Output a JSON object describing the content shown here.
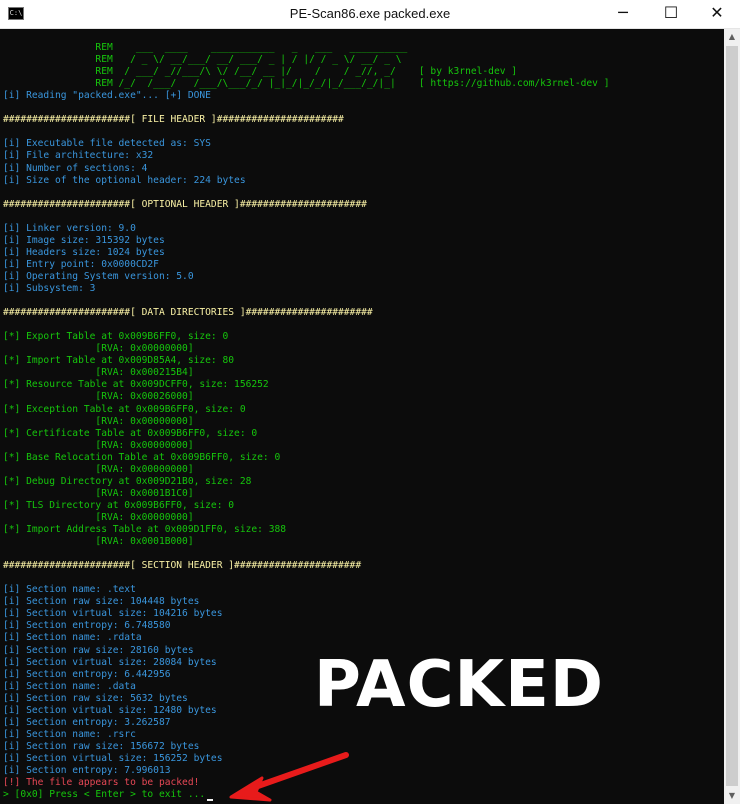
{
  "window": {
    "title": "PE-Scan86.exe  packed.exe",
    "icon_label": "C:\\",
    "buttons": {
      "minimize": "─",
      "maximize": "☐",
      "close": "✕"
    }
  },
  "console": {
    "lines": [
      {
        "text": "                REM    ___  ____    ___________   _   ___   __________",
        "color": "green"
      },
      {
        "text": "                REM   / _ \\/ __/___/ __/ ___/ _ | / |/ / _ \\/ __/ _ \\",
        "color": "green"
      },
      {
        "text": "                REM  / ___/ _//___/\\ \\/ /__/ __ |/    /    / _//, _/    [ by k3rnel-dev ]",
        "color": "green"
      },
      {
        "text": "                REM /_/  /___/   /___/\\___/_/ |_|_/|_/_/|_/___/_/|_|    [ https://github.com/k3rnel-dev ]",
        "color": "green"
      },
      {
        "text": "[i] Reading \"packed.exe\"... [+] DONE",
        "color": "cyan"
      },
      {
        "text": "",
        "color": "gray"
      },
      {
        "text": "######################[ FILE HEADER ]######################",
        "color": "yellow"
      },
      {
        "text": "",
        "color": "gray"
      },
      {
        "text": "[i] Executable file detected as: SYS",
        "color": "cyan"
      },
      {
        "text": "[i] File architecture: x32",
        "color": "cyan"
      },
      {
        "text": "[i] Number of sections: 4",
        "color": "cyan"
      },
      {
        "text": "[i] Size of the optional header: 224 bytes",
        "color": "cyan"
      },
      {
        "text": "",
        "color": "gray"
      },
      {
        "text": "######################[ OPTIONAL HEADER ]######################",
        "color": "yellow"
      },
      {
        "text": "",
        "color": "gray"
      },
      {
        "text": "[i] Linker version: 9.0",
        "color": "cyan"
      },
      {
        "text": "[i] Image size: 315392 bytes",
        "color": "cyan"
      },
      {
        "text": "[i] Headers size: 1024 bytes",
        "color": "cyan"
      },
      {
        "text": "[i] Entry point: 0x0000CD2F",
        "color": "cyan"
      },
      {
        "text": "[i] Operating System version: 5.0",
        "color": "cyan"
      },
      {
        "text": "[i] Subsystem: 3",
        "color": "cyan"
      },
      {
        "text": "",
        "color": "gray"
      },
      {
        "text": "######################[ DATA DIRECTORIES ]######################",
        "color": "yellow"
      },
      {
        "text": "",
        "color": "gray"
      },
      {
        "text": "[*] Export Table at 0x009B6FF0, size: 0",
        "color": "green"
      },
      {
        "text": "                [RVA: 0x00000000]",
        "color": "green"
      },
      {
        "text": "[*] Import Table at 0x009D85A4, size: 80",
        "color": "green"
      },
      {
        "text": "                [RVA: 0x000215B4]",
        "color": "green"
      },
      {
        "text": "[*] Resource Table at 0x009DCFF0, size: 156252",
        "color": "green"
      },
      {
        "text": "                [RVA: 0x00026000]",
        "color": "green"
      },
      {
        "text": "[*] Exception Table at 0x009B6FF0, size: 0",
        "color": "green"
      },
      {
        "text": "                [RVA: 0x00000000]",
        "color": "green"
      },
      {
        "text": "[*] Certificate Table at 0x009B6FF0, size: 0",
        "color": "green"
      },
      {
        "text": "                [RVA: 0x00000000]",
        "color": "green"
      },
      {
        "text": "[*] Base Relocation Table at 0x009B6FF0, size: 0",
        "color": "green"
      },
      {
        "text": "                [RVA: 0x00000000]",
        "color": "green"
      },
      {
        "text": "[*] Debug Directory at 0x009D21B0, size: 28",
        "color": "green"
      },
      {
        "text": "                [RVA: 0x0001B1C0]",
        "color": "green"
      },
      {
        "text": "[*] TLS Directory at 0x009B6FF0, size: 0",
        "color": "green"
      },
      {
        "text": "                [RVA: 0x00000000]",
        "color": "green"
      },
      {
        "text": "[*] Import Address Table at 0x009D1FF0, size: 388",
        "color": "green"
      },
      {
        "text": "                [RVA: 0x0001B000]",
        "color": "green"
      },
      {
        "text": "",
        "color": "gray"
      },
      {
        "text": "######################[ SECTION HEADER ]######################",
        "color": "yellow"
      },
      {
        "text": "",
        "color": "gray"
      },
      {
        "text": "[i] Section name: .text",
        "color": "cyan"
      },
      {
        "text": "[i] Section raw size: 104448 bytes",
        "color": "cyan"
      },
      {
        "text": "[i] Section virtual size: 104216 bytes",
        "color": "cyan"
      },
      {
        "text": "[i] Section entropy: 6.748580",
        "color": "cyan"
      },
      {
        "text": "[i] Section name: .rdata",
        "color": "cyan"
      },
      {
        "text": "[i] Section raw size: 28160 bytes",
        "color": "cyan"
      },
      {
        "text": "[i] Section virtual size: 28084 bytes",
        "color": "cyan"
      },
      {
        "text": "[i] Section entropy: 6.442956",
        "color": "cyan"
      },
      {
        "text": "[i] Section name: .data",
        "color": "cyan"
      },
      {
        "text": "[i] Section raw size: 5632 bytes",
        "color": "cyan"
      },
      {
        "text": "[i] Section virtual size: 12480 bytes",
        "color": "cyan"
      },
      {
        "text": "[i] Section entropy: 3.262587",
        "color": "cyan"
      },
      {
        "text": "[i] Section name: .rsrc",
        "color": "cyan"
      },
      {
        "text": "[i] Section raw size: 156672 bytes",
        "color": "cyan"
      },
      {
        "text": "[i] Section virtual size: 156252 bytes",
        "color": "cyan"
      },
      {
        "text": "[i] Section entropy: 7.996013",
        "color": "cyan"
      },
      {
        "text": "[!] The file appears to be packed!",
        "color": "red"
      },
      {
        "text": "> [0x0] Press < Enter > to exit ...",
        "color": "green",
        "cursor": true
      }
    ]
  },
  "overlay": {
    "stamp": "PACKED",
    "arrow_color": "#e81b1b"
  },
  "colors": {
    "green": "#16c60c",
    "cyan": "#3a96dd",
    "yellow": "#f9f1a5",
    "red": "#e74856"
  }
}
